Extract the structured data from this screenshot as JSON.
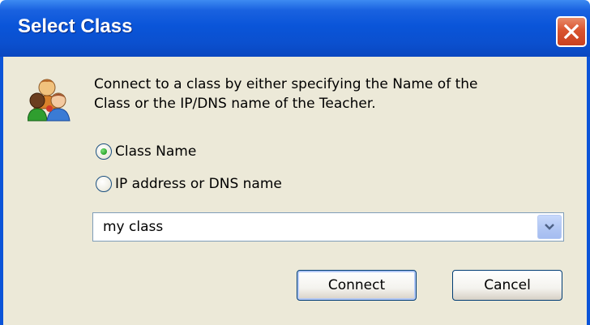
{
  "window": {
    "title": "Select Class"
  },
  "dialog": {
    "description_line1": "Connect to a class by either specifying the Name of the",
    "description_line2": "Class or the IP/DNS name of the Teacher.",
    "radio_options": [
      {
        "label": "Class Name",
        "checked": true
      },
      {
        "label": "IP address or DNS name",
        "checked": false
      }
    ],
    "combo": {
      "value": "my class"
    },
    "connect_label": "Connect",
    "cancel_label": "Cancel"
  },
  "icons": {
    "dialog_icon": "users-icon",
    "close": "close-icon",
    "dropdown": "chevron-down-icon"
  },
  "colors": {
    "titlebar": "#0a55d9",
    "client": "#ece9d8",
    "close_button": "#d9542f"
  }
}
